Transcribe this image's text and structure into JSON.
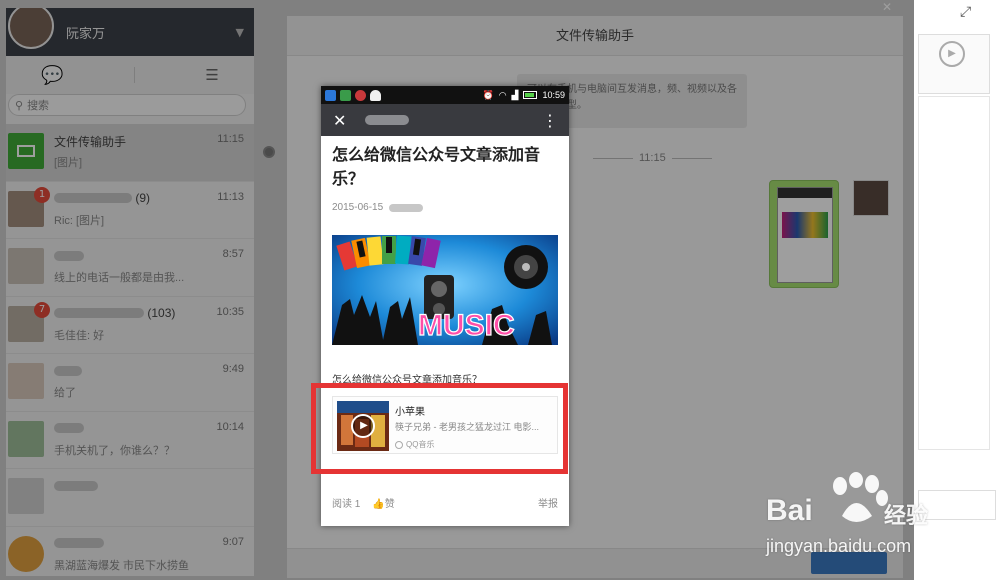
{
  "sidebar": {
    "user_name": "阮家万",
    "search_placeholder": "搜索",
    "chats": [
      {
        "name": "文件传输助手",
        "preview": "[图片]",
        "time": "11:15",
        "badge": ""
      },
      {
        "name": "(9)",
        "preview": "Ric: [图片]",
        "time": "11:13",
        "badge": "1"
      },
      {
        "name": "",
        "preview": "线上的电话一般都是由我...",
        "time": "8:57",
        "badge": ""
      },
      {
        "name": "(103)",
        "preview": "毛佳佳: 好",
        "time": "10:35",
        "badge": "7"
      },
      {
        "name": "",
        "preview": "给了",
        "time": "9:49",
        "badge": ""
      },
      {
        "name": "",
        "preview": "手机关机了，你谁么？？",
        "time": "10:14",
        "badge": ""
      },
      {
        "name": "",
        "preview": "",
        "time": "",
        "badge": ""
      },
      {
        "name": "",
        "preview": "黑湖蓝海爆发 市民下水捞鱼",
        "time": "9:07",
        "badge": ""
      }
    ]
  },
  "conversation": {
    "title": "文件传输助手",
    "system_note": "可以在手机与电脑间互发消息，频、视频以及各种文件类型。",
    "time_divider": "11:15"
  },
  "phone": {
    "status_time": "10:59",
    "article": {
      "title": "怎么给微信公众号文章添加音乐？",
      "date": "2015-06-15",
      "cover_text": "MUSIC",
      "subtitle": "怎么给微信公众号文章添加音乐？",
      "music": {
        "title": "小苹果",
        "artist": "筷子兄弟 - 老男孩之猛龙过江 电影...",
        "source": "QQ音乐"
      },
      "reads": "阅读 1",
      "likes": "赞",
      "report": "举报"
    }
  },
  "watermark": {
    "brand": "Bai",
    "brand_cn": "经验",
    "url": "jingyan.baidu.com"
  },
  "colors": {
    "highlight": "#e53434",
    "nav_bar": "#393a3f",
    "accent_green": "#3fab38"
  }
}
